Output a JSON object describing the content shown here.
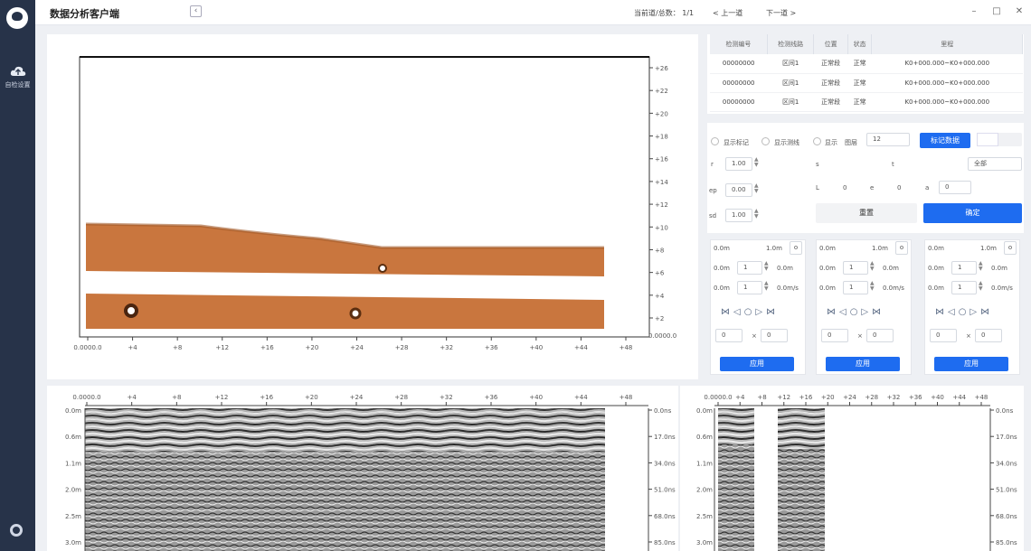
{
  "sidebar": {
    "logo": "logo-icon",
    "item_label": "自检设置",
    "item_icon": "cloud-upload-icon",
    "bottom_icon": "settings-icon"
  },
  "header": {
    "title": "数据分析客户端",
    "counter_label": "当前道/总数：",
    "counter_value": "1/1",
    "prev": "上一道",
    "next": "下一道"
  },
  "top_plot": {
    "x_ticks": [
      "0.0000.0",
      "+4",
      "+8",
      "+12",
      "+16",
      "+20",
      "+24",
      "+28",
      "+32",
      "+36",
      "+40",
      "+44",
      "+48"
    ],
    "y_ticks": [
      "+26",
      "+22",
      "+20",
      "+18",
      "+16",
      "+14",
      "+12",
      "+10",
      "+8",
      "+6",
      "+4",
      "+2"
    ],
    "y_unit": "0.0000.0"
  },
  "table": {
    "headers": [
      "检测编号",
      "检测线路",
      "位置",
      "状态",
      "里程"
    ],
    "rows": [
      [
        "00000000",
        "区间1",
        "正常段",
        "正常",
        "K0+000.000~K0+000.000"
      ],
      [
        "00000000",
        "区间1",
        "正常段",
        "正常",
        "K0+000.000~K0+000.000"
      ],
      [
        "00000000",
        "区间1",
        "正常段",
        "正常",
        "K0+000.000~K0+000.000"
      ]
    ]
  },
  "controls": {
    "opt1": "显示标记",
    "opt2": "显示测线",
    "opt3": "显示",
    "opt3b": "图层",
    "select_value": "12",
    "mark_btn": "标记数据",
    "p1": "1.00",
    "p2": "0.00",
    "p3": "1.00",
    "right_select": "全部",
    "L": "L",
    "lv": "0",
    "e": "e",
    "ev": "0",
    "a": "a",
    "av": "0",
    "reset": "重置",
    "confirm": "确定"
  },
  "subpanels": [
    {
      "h1": "0.0m",
      "h2": "1.0m",
      "r1": "0.0m",
      "r1v": "1",
      "r1u": "0.0m",
      "r2": "0.0m",
      "r2v": "1",
      "r2u": "0.0m/s",
      "n1": "0",
      "n2": "0",
      "btn": "应用"
    },
    {
      "h1": "0.0m",
      "h2": "1.0m",
      "r1": "0.0m",
      "r1v": "1",
      "r1u": "0.0m",
      "r2": "0.0m",
      "r2v": "1",
      "r2u": "0.0m/s",
      "n1": "0",
      "n2": "0",
      "btn": "应用"
    },
    {
      "h1": "0.0m",
      "h2": "1.0m",
      "r1": "0.0m",
      "r1v": "1",
      "r1u": "0.0m",
      "r2": "0.0m",
      "r2v": "1",
      "r2u": "0.0m/s",
      "n1": "0",
      "n2": "0",
      "btn": "应用"
    }
  ],
  "radar_left": {
    "x_ticks": [
      "0.0000.0",
      "+4",
      "+8",
      "+12",
      "+16",
      "+20",
      "+24",
      "+28",
      "+32",
      "+36",
      "+40",
      "+44",
      "+48"
    ],
    "y_left": [
      "0.0m",
      "0.6m",
      "1.1m",
      "2.0m",
      "2.5m",
      "3.0m"
    ],
    "y_right": [
      "0.0ns",
      "17.0ns",
      "34.0ns",
      "51.0ns",
      "68.0ns",
      "85.0ns"
    ]
  },
  "radar_right": {
    "x_ticks": [
      "0.0000.0",
      "+4",
      "+8",
      "+12",
      "+16",
      "+20",
      "+24",
      "+28",
      "+32",
      "+36",
      "+40",
      "+44",
      "+48"
    ],
    "y_left": [
      "0.0m",
      "0.6m",
      "1.1m",
      "2.0m",
      "2.5m",
      "3.0m"
    ],
    "y_right": [
      "0.0ns",
      "17.0ns",
      "34.0ns",
      "51.0ns",
      "68.0ns",
      "85.0ns"
    ]
  },
  "colors": {
    "sidebar": "#273349",
    "accent": "#1e6cf0",
    "wood": "#c9763e"
  }
}
